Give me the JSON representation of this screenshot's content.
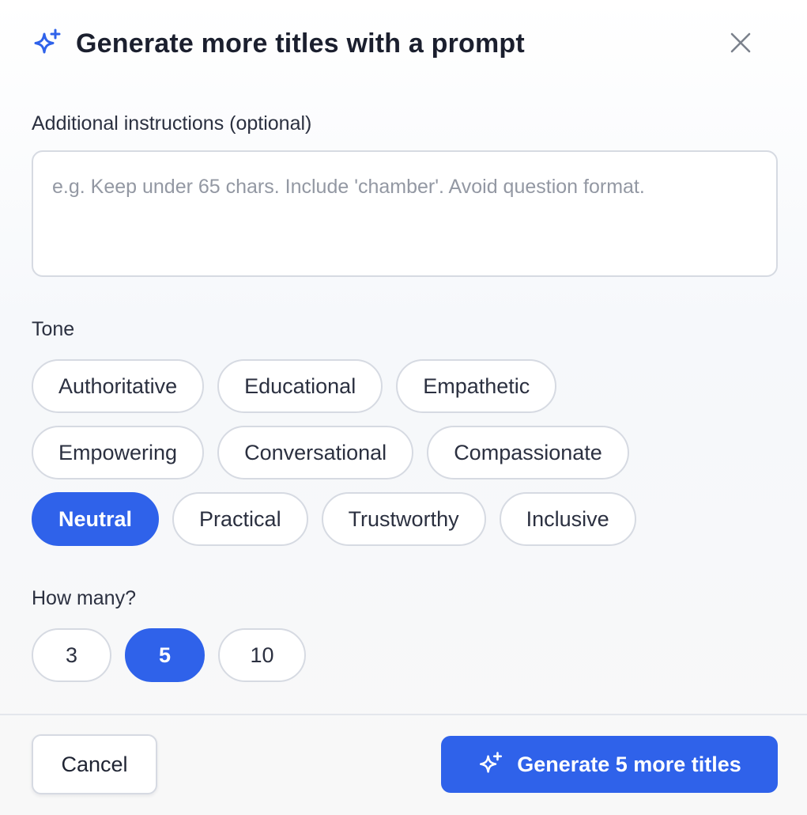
{
  "dialog": {
    "title": "Generate more titles with a prompt",
    "title_icon": "sparkle-icon",
    "close_icon": "close-icon"
  },
  "instructions": {
    "label": "Additional instructions (optional)",
    "value": "",
    "placeholder": "e.g. Keep under 65 chars. Include 'chamber'. Avoid question format."
  },
  "tone": {
    "label": "Tone",
    "selected": "Neutral",
    "rows": [
      [
        "Authoritative",
        "Educational",
        "Empathetic"
      ],
      [
        "Empowering",
        "Conversational",
        "Compassionate"
      ],
      [
        "Neutral",
        "Practical",
        "Trustworthy",
        "Inclusive"
      ]
    ]
  },
  "count": {
    "label": "How many?",
    "options": [
      "3",
      "5",
      "10"
    ],
    "selected": "5"
  },
  "footer": {
    "cancel_label": "Cancel",
    "generate_label": "Generate 5 more titles",
    "generate_icon": "sparkle-icon"
  },
  "colors": {
    "accent": "#2f62ea",
    "border": "#d6dae2",
    "text": "#1f2433",
    "placeholder": "#9398a3"
  }
}
